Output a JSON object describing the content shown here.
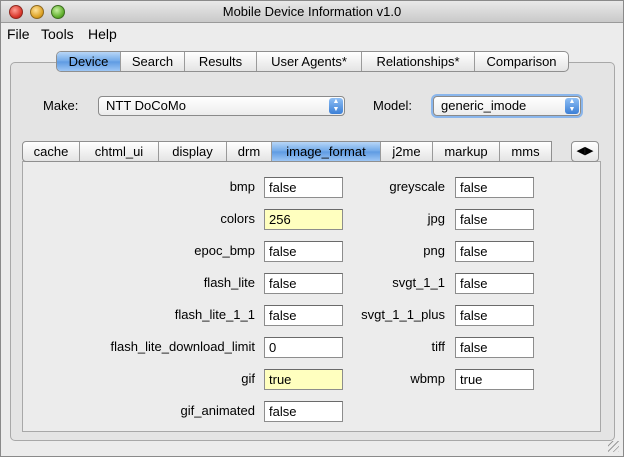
{
  "window": {
    "title": "Mobile Device Information v1.0"
  },
  "menu": {
    "items": [
      "File",
      "Tools",
      "Help"
    ]
  },
  "top_tabs": [
    {
      "label": "Device",
      "selected": true
    },
    {
      "label": "Search",
      "selected": false
    },
    {
      "label": "Results",
      "selected": false
    },
    {
      "label": "User Agents*",
      "selected": false
    },
    {
      "label": "Relationships*",
      "selected": false
    },
    {
      "label": "Comparison",
      "selected": false
    }
  ],
  "make": {
    "label": "Make:",
    "value": "NTT DoCoMo"
  },
  "model": {
    "label": "Model:",
    "value": "generic_imode"
  },
  "inner_tabs": [
    {
      "label": "cache",
      "selected": false
    },
    {
      "label": "chtml_ui",
      "selected": false
    },
    {
      "label": "display",
      "selected": false
    },
    {
      "label": "drm",
      "selected": false
    },
    {
      "label": "image_format",
      "selected": true
    },
    {
      "label": "j2me",
      "selected": false
    },
    {
      "label": "markup",
      "selected": false
    },
    {
      "label": "mms",
      "selected": false
    }
  ],
  "scroll_tab_icon": "left-right-arrows-icon",
  "properties_left": [
    {
      "name": "bmp",
      "value": "false",
      "highlight": false
    },
    {
      "name": "colors",
      "value": "256",
      "highlight": true
    },
    {
      "name": "epoc_bmp",
      "value": "false",
      "highlight": false
    },
    {
      "name": "flash_lite",
      "value": "false",
      "highlight": false
    },
    {
      "name": "flash_lite_1_1",
      "value": "false",
      "highlight": false
    },
    {
      "name": "flash_lite_download_limit",
      "value": "0",
      "highlight": false
    },
    {
      "name": "gif",
      "value": "true",
      "highlight": true
    },
    {
      "name": "gif_animated",
      "value": "false",
      "highlight": false
    }
  ],
  "properties_right": [
    {
      "name": "greyscale",
      "value": "false",
      "highlight": false
    },
    {
      "name": "jpg",
      "value": "false",
      "highlight": false
    },
    {
      "name": "png",
      "value": "false",
      "highlight": false
    },
    {
      "name": "svgt_1_1",
      "value": "false",
      "highlight": false
    },
    {
      "name": "svgt_1_1_plus",
      "value": "false",
      "highlight": false
    },
    {
      "name": "tiff",
      "value": "false",
      "highlight": false
    },
    {
      "name": "wbmp",
      "value": "true",
      "highlight": false
    }
  ],
  "colors": {
    "selected_tab": "#6ea7e8",
    "highlight_field": "#ffffbf"
  }
}
